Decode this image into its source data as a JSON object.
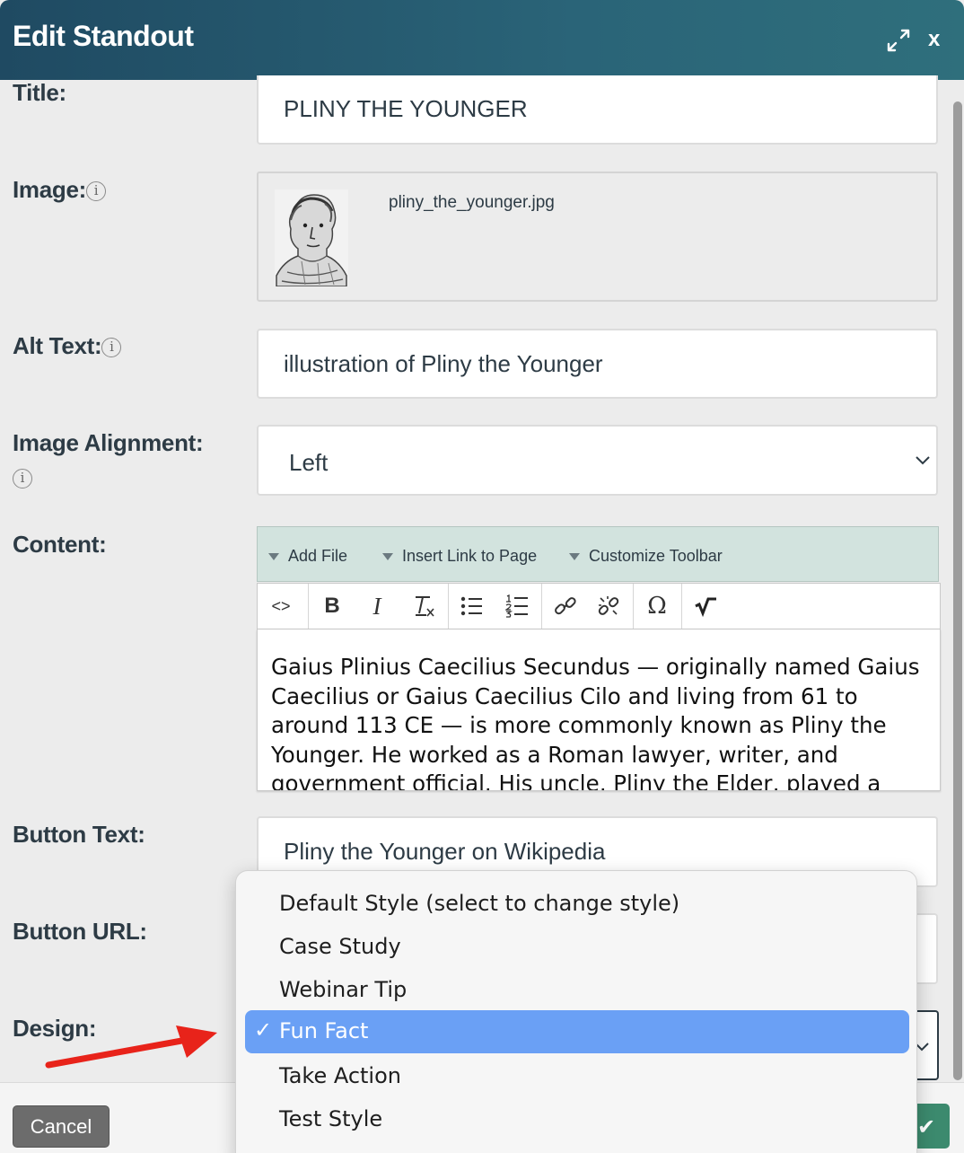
{
  "header": {
    "title": "Edit Standout",
    "close_label": "x"
  },
  "form": {
    "title_label": "Title:",
    "title_value": "PLINY THE YOUNGER",
    "image_label": "Image:",
    "image_filename": "pliny_the_younger.jpg",
    "alt_label": "Alt Text:",
    "alt_value": "illustration of Pliny the Younger",
    "alignment_label": "Image Alignment:",
    "alignment_value": "Left",
    "content_label": "Content:",
    "button_text_label": "Button Text:",
    "button_text_value": "Pliny the Younger on Wikipedia",
    "button_url_label": "Button URL:",
    "design_label": "Design:",
    "info_glyph": "i"
  },
  "editor": {
    "menu": [
      "Add File",
      "Insert Link to Page",
      "Customize Toolbar"
    ],
    "icons": [
      "source-icon",
      "bold-icon",
      "italic-icon",
      "clear-format-icon",
      "bulleted-list-icon",
      "numbered-list-icon",
      "link-icon",
      "unlink-icon",
      "special-char-icon",
      "math-icon"
    ],
    "buttons": {
      "source": "<>",
      "bold": "B",
      "italic": "I",
      "omega": "Ω"
    },
    "content": "Gaius Plinius Caecilius Secundus — originally named Gaius Caecilius or Gaius Caecilius Cilo and living from 61 to around 113 CE — is more commonly known as Pliny the Younger. He worked as a Roman lawyer, writer, and government official. His uncle, Pliny the Elder, played a"
  },
  "dropdown": {
    "options": [
      "Default Style (select to change style)",
      "Case Study",
      "Webinar Tip",
      "Fun Fact",
      "Take Action",
      "Test Style"
    ],
    "selected": "Fun Fact",
    "check": "✓"
  },
  "footer": {
    "cancel_label": "Cancel",
    "save_check": "✔"
  },
  "colors": {
    "header": "#1f4a62",
    "selection": "#6aa0f5",
    "save": "#3c8a6e",
    "arrow": "#e8231a"
  }
}
